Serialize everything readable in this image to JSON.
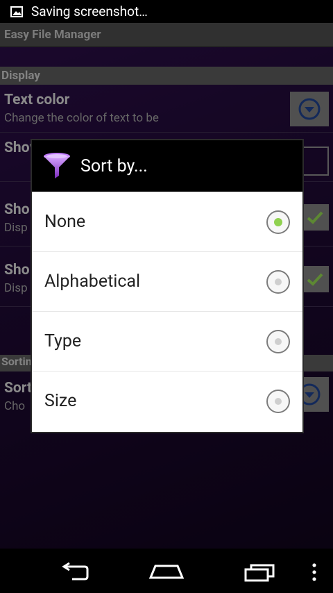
{
  "status_bar": {
    "text": "Saving screenshot…"
  },
  "app": {
    "title": "Easy File Manager",
    "section_display": "Display",
    "prefs": [
      {
        "title": "Text color",
        "summary": "Change the color of text to be"
      },
      {
        "title": "Show hidden files/folders",
        "summary": ""
      },
      {
        "title": "Sho",
        "summary": "Disp"
      },
      {
        "title": "Sho",
        "summary": "Disp"
      }
    ],
    "section_sorting": "Sorting",
    "sort_pref": {
      "title": "Sort",
      "summary": "Cho"
    }
  },
  "dialog": {
    "title": "Sort by...",
    "options": [
      {
        "label": "None",
        "checked": true
      },
      {
        "label": "Alphabetical",
        "checked": false
      },
      {
        "label": "Type",
        "checked": false
      },
      {
        "label": "Size",
        "checked": false
      }
    ]
  },
  "colors": {
    "accent_radio": "#8fd14f",
    "funnel": "#a64be0"
  }
}
